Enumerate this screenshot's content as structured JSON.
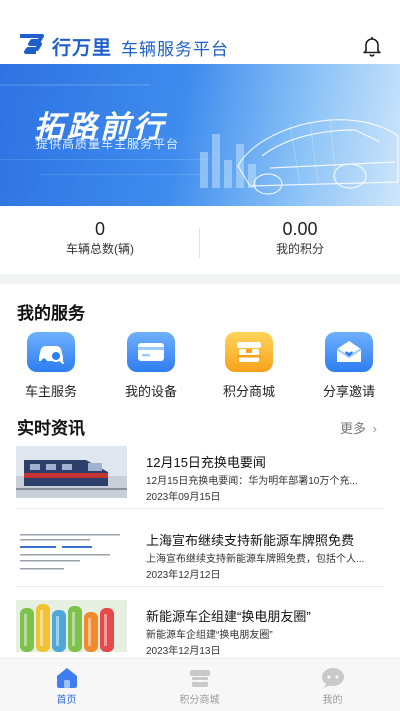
{
  "header": {
    "brand": "行万里",
    "platform": "车辆服务平台"
  },
  "banner": {
    "title": "拓路前行",
    "subtitle": "提供高质量车主服务平台"
  },
  "stats": [
    {
      "value": "0",
      "label": "车辆总数(辆)"
    },
    {
      "value": "0.00",
      "label": "我的积分"
    }
  ],
  "services": {
    "title": "我的服务",
    "items": [
      {
        "label": "车主服务",
        "icon": "car-search-icon"
      },
      {
        "label": "我的设备",
        "icon": "device-card-icon"
      },
      {
        "label": "积分商城",
        "icon": "points-mall-icon"
      },
      {
        "label": "分享邀请",
        "icon": "share-mail-icon"
      }
    ]
  },
  "news": {
    "title": "实时资讯",
    "more": "更多",
    "items": [
      {
        "title": "12月15日充换电要闻",
        "summary": "12月15日充换电要闻：华为明年部署10万个充...",
        "date": "2023年09月15日",
        "thumb": "train-photo"
      },
      {
        "title": "上海宣布继续支持新能源车牌照免费",
        "summary": "上海宣布继续支持新能源车牌照免费，包括个人...",
        "date": "2023年12月12日",
        "thumb": "document-photo"
      },
      {
        "title": "新能源车企组建“换电朋友圈”",
        "summary": "新能源车企组建“换电朋友圈”",
        "date": "2023年12月13日",
        "thumb": "batteries-photo"
      }
    ]
  },
  "tabbar": {
    "items": [
      {
        "label": "首页",
        "icon": "home-icon",
        "active": true
      },
      {
        "label": "积分商城",
        "icon": "mall-icon",
        "active": false
      },
      {
        "label": "我的",
        "icon": "profile-chat-icon",
        "active": false
      }
    ]
  },
  "colors": {
    "brand": "#1e5fc9",
    "tab_active": "#2f6ee0",
    "tab_inactive": "#9a9a9a"
  }
}
